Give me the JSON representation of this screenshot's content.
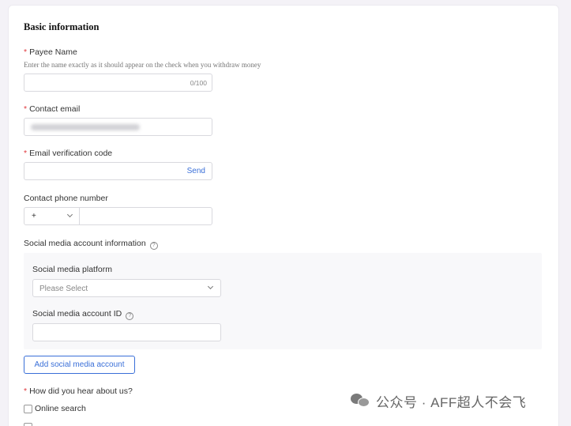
{
  "section": {
    "title": "Basic information"
  },
  "payee": {
    "label": "Payee Name",
    "required_mark": "*",
    "hint": "Enter the name exactly as it should appear on the check when you withdraw money",
    "counter": "0/100"
  },
  "contact_email": {
    "label": "Contact email",
    "required_mark": "*"
  },
  "email_verification": {
    "label": "Email verification code",
    "required_mark": "*",
    "send_label": "Send"
  },
  "contact_phone": {
    "label": "Contact phone number",
    "country_code": "+"
  },
  "social": {
    "section_label": "Social media account information",
    "help_glyph": "?",
    "platform_label": "Social media platform",
    "platform_placeholder": "Please Select",
    "account_id_label": "Social media account ID",
    "add_button": "Add social media account"
  },
  "referral": {
    "label": "How did you hear about us?",
    "required_mark": "*",
    "options": [
      "Online search"
    ]
  },
  "watermark": {
    "text": "公众号 · AFF超人不会飞"
  }
}
